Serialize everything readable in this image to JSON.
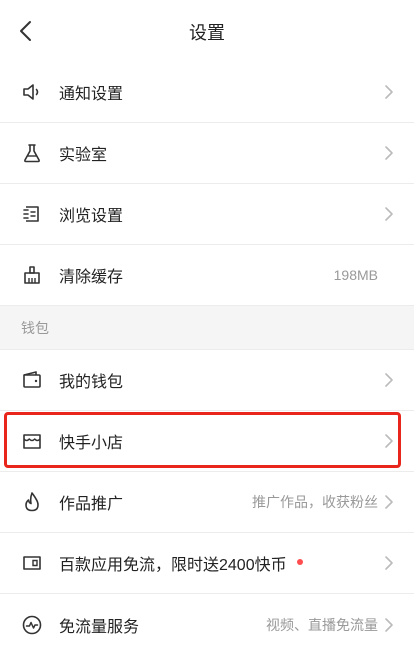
{
  "header": {
    "title": "设置",
    "back_icon": "chevron-left-icon"
  },
  "settings_items": [
    {
      "label": "通知设置",
      "value": "",
      "icon": "speaker-icon"
    },
    {
      "label": "实验室",
      "value": "",
      "icon": "flask-icon"
    },
    {
      "label": "浏览设置",
      "value": "",
      "icon": "browse-icon"
    },
    {
      "label": "清除缓存",
      "value": "198MB",
      "icon": "broom-icon"
    }
  ],
  "wallet_section": {
    "title": "钱包",
    "items": [
      {
        "label": "我的钱包",
        "value": "",
        "icon": "wallet-icon"
      },
      {
        "label": "快手小店",
        "value": "",
        "icon": "store-icon",
        "highlighted": true
      },
      {
        "label": "作品推广",
        "value": "推广作品，收获粉丝",
        "icon": "flame-icon"
      },
      {
        "label": "百款应用免流，限时送2400快币",
        "value": "",
        "icon": "ticket-icon",
        "badge_dot": true
      },
      {
        "label": "免流量服务",
        "value": "视频、直播免流量",
        "icon": "pulse-icon"
      }
    ]
  },
  "colors": {
    "highlight": "#e8261c",
    "badge_dot": "#ff4d4f",
    "secondary_text": "#999999"
  }
}
